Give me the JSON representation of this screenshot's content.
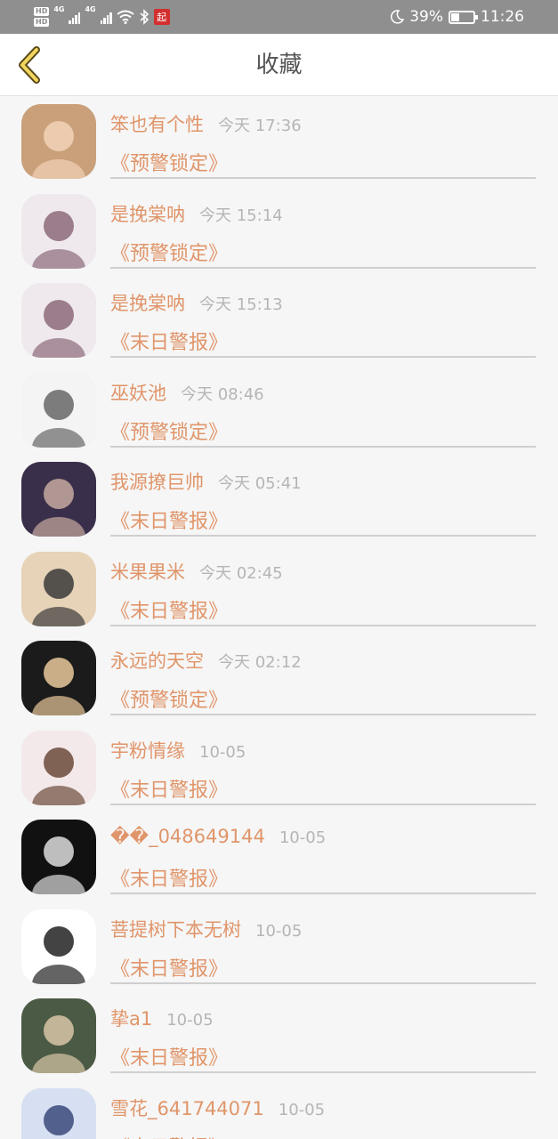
{
  "status_bar": {
    "network_1": "4G",
    "network_2": "4G",
    "battery": "39%",
    "time": "11:26",
    "app_badge": "起",
    "battery_level": 0.39
  },
  "header": {
    "title": "收藏",
    "back_icon": "chevron-left-icon"
  },
  "favorites": [
    {
      "name": "笨也有个性",
      "time": "今天 17:36",
      "subject": "《预警锁定》"
    },
    {
      "name": "是挽棠呐",
      "time": "今天 15:14",
      "subject": "《预警锁定》"
    },
    {
      "name": "是挽棠呐",
      "time": "今天 15:13",
      "subject": "《末日警报》"
    },
    {
      "name": "巫妖池",
      "time": "今天 08:46",
      "subject": "《预警锁定》"
    },
    {
      "name": "我源撩巨帅",
      "time": "今天 05:41",
      "subject": "《末日警报》"
    },
    {
      "name": "米果果米",
      "time": "今天 02:45",
      "subject": "《末日警报》"
    },
    {
      "name": "永远的天空",
      "time": "今天 02:12",
      "subject": "《预警锁定》"
    },
    {
      "name": "宇粉情缘",
      "time": "10-05",
      "subject": "《末日警报》"
    },
    {
      "name": "��_048649144",
      "time": "10-05",
      "subject": "《末日警报》"
    },
    {
      "name": "菩提树下本无树",
      "time": "10-05",
      "subject": "《末日警报》"
    },
    {
      "name": "挚a1",
      "time": "10-05",
      "subject": "《末日警报》"
    },
    {
      "name": "雪花_641744071",
      "time": "10-05",
      "subject": "《末日警报》"
    }
  ],
  "colors": {
    "accent": "#e0956a",
    "muted": "#b5b5b5",
    "status_bar": "#8f8f8f"
  }
}
